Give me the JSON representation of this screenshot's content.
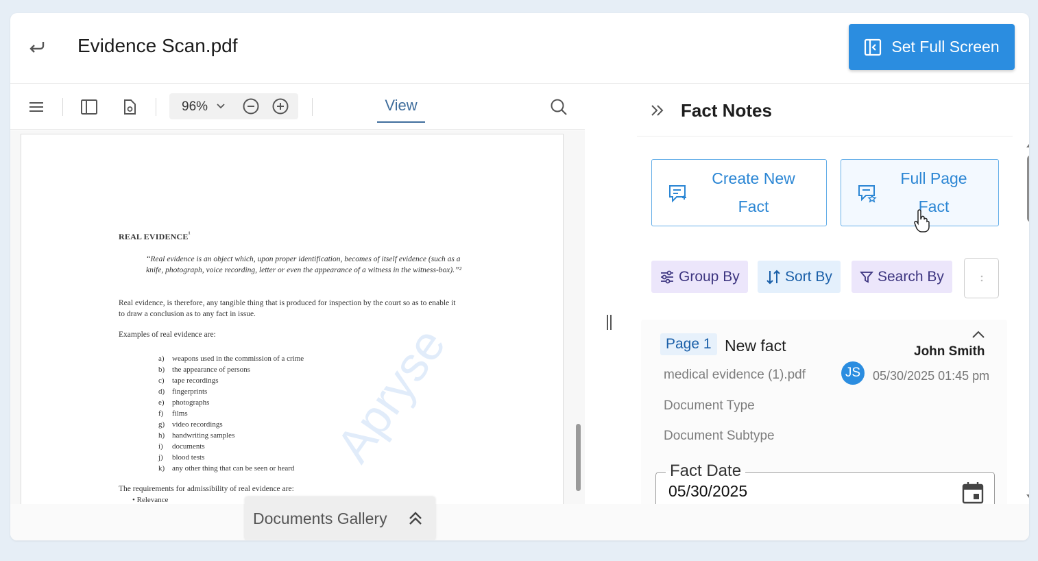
{
  "header": {
    "title": "Evidence Scan.pdf",
    "fullscreen_label": "Set Full Screen",
    "back_icon": "return-arrow-icon"
  },
  "viewer": {
    "zoom": "96%",
    "view_tab": "View",
    "toolbar_icons": [
      "menu-icon",
      "sidebar-panel-icon",
      "document-settings-icon",
      "zoom-out-icon",
      "zoom-in-icon",
      "search-icon"
    ],
    "page": {
      "heading": "REAL EVIDENCE",
      "heading_sup": "¹",
      "quote": "“Real evidence is an object which, upon proper identification, becomes of itself evidence (such as a knife, photograph, voice recording, letter or even the appearance of a witness in the witness-box).”²",
      "paragraph": "Real evidence, is therefore, any tangible thing that is produced for inspection by the court so as to enable it to draw a conclusion as to any fact in issue.",
      "examples_intro": "Examples of real evidence are:",
      "examples": [
        {
          "k": "a)",
          "t": "weapons used in the commission of a crime"
        },
        {
          "k": "b)",
          "t": "the appearance of persons"
        },
        {
          "k": "c)",
          "t": "tape recordings"
        },
        {
          "k": "d)",
          "t": "fingerprints"
        },
        {
          "k": "e)",
          "t": "photographs"
        },
        {
          "k": "f)",
          "t": "films"
        },
        {
          "k": "g)",
          "t": "video recordings"
        },
        {
          "k": "h)",
          "t": "handwriting samples"
        },
        {
          "k": "i)",
          "t": "documents"
        },
        {
          "k": "j)",
          "t": "blood tests"
        },
        {
          "k": "k)",
          "t": "any other thing that can be seen or heard"
        }
      ],
      "requirements": "The requirements for admissibility of real evidence are:",
      "relevance": "•   Relevance",
      "watermark": "Apryse"
    }
  },
  "panel": {
    "title": "Fact Notes",
    "create_label_1": "Create New",
    "create_label_2": "Fact",
    "fullpage_label_1": "Full Page",
    "fullpage_label_2": "Fact",
    "filters": {
      "group": "Group By",
      "sort": "Sort By",
      "search": "Search By"
    },
    "fact": {
      "page_badge": "Page 1",
      "name": "New fact",
      "author": "John Smith",
      "initials": "JS",
      "timestamp": "05/30/2025 01:45 pm",
      "source_file": "medical evidence (1).pdf",
      "doc_type": "Document Type",
      "doc_subtype": "Document Subtype",
      "date_label": "Fact Date",
      "date_value": "05/30/2025"
    }
  },
  "footer": {
    "gallery_label": "Documents Gallery"
  },
  "colors": {
    "accent": "#2b8de0",
    "chip_purple_bg": "#ece6fb",
    "chip_blue_bg": "#e4f0fc"
  }
}
